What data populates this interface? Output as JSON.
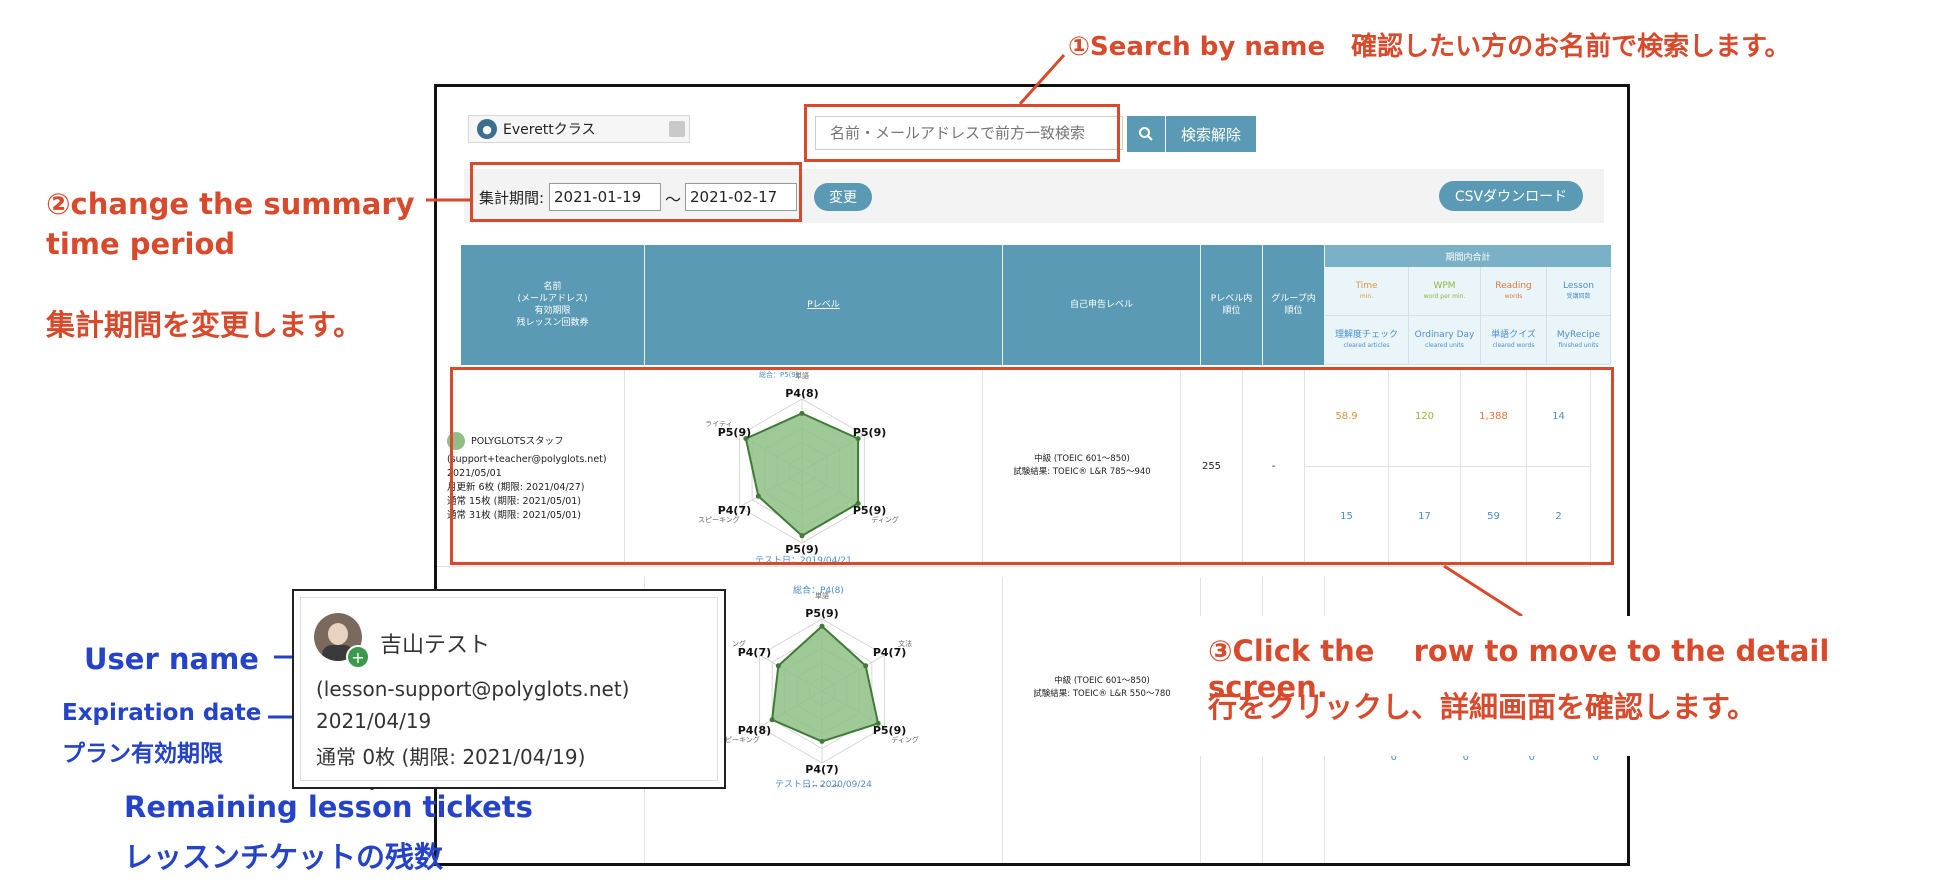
{
  "annotations": {
    "search": "①Search by name　確認したい方のお名前で検索します。",
    "period_en": "②change the summary\ntime period",
    "period_jp": "集計期間を変更します。",
    "click_en": "③Click the　 row to move to the detail screen.",
    "click_jp": "行をクリックし、詳細画面を確認します。",
    "user_name": "User name",
    "expiration_en": "Expiration date",
    "expiration_jp": "プラン有効期限",
    "tickets_en": "Remaining lesson tickets",
    "tickets_jp": "レッスンチケットの残数"
  },
  "toolbar": {
    "class_name": "Everettクラス",
    "search_placeholder": "名前・メールアドレスで前方一致検索",
    "clear_label": "検索解除",
    "period_label": "集計期間:",
    "date_from": "2021-01-19",
    "tilde": "〜",
    "date_to": "2021-02-17",
    "change_label": "変更",
    "csv_label": "CSVダウンロード"
  },
  "table": {
    "headers": {
      "name": "名前\n(メールアドレス)\n有効期限\n残レッスン回数券",
      "plevel": "Pレベル",
      "self": "自己申告レベル",
      "rank": "Pレベル内\n順位",
      "group_rank": "グループ内\n順位",
      "period_total": "期間内合計"
    },
    "subheaders": [
      {
        "top": "Time",
        "top_sub": "min.",
        "bottom": "理解度チェック",
        "bottom_sub": "cleared articles",
        "color": "#e0953b"
      },
      {
        "top": "WPM",
        "top_sub": "word per min.",
        "bottom": "Ordinary Day",
        "bottom_sub": "cleared units",
        "color": "#8bb93c"
      },
      {
        "top": "Reading",
        "top_sub": "words",
        "bottom": "単語クイズ",
        "bottom_sub": "cleared words",
        "color": "#e07a3b"
      },
      {
        "top": "Lesson",
        "top_sub": "受講回数",
        "bottom": "MyRecipe",
        "bottom_sub": "finished units",
        "color": "#4a8fd0"
      }
    ],
    "rows": [
      {
        "name": "POLYGLOTSスタッフ",
        "email": "(support+teacher@polyglots.net)",
        "expiry": "2021/05/01",
        "tickets": [
          "月更新 6枚 (期限: 2021/04/27)",
          "通常 15枚 (期限: 2021/05/01)",
          "通常 31枚 (期限: 2021/05/01)"
        ],
        "radar_labels": {
          "top": "P4(8)",
          "tr": "P5(9)",
          "br": "P5(9)",
          "bottom": "P5(9)",
          "bl": "P4(7)",
          "tl": "P5(9)"
        },
        "radar_axis": {
          "top": "単語",
          "tr": "",
          "br": "ディング",
          "bottom": "",
          "bl": "スピーキング",
          "tl": "ライティ"
        },
        "radar_values": [
          0.8,
          0.9,
          0.9,
          0.9,
          0.7,
          0.9
        ],
        "overall": "総合：P5(9)",
        "test_date": "テスト日：2019/04/21",
        "self_level": "中級 (TOEIC 601〜850)",
        "self_test": "試験結果: TOEIC® L&R 785〜940",
        "rank": "255",
        "group_rank": "-",
        "top_vals": [
          "58.9",
          "120",
          "1,388",
          "14"
        ],
        "bottom_vals": [
          "15",
          "17",
          "59",
          "2"
        ]
      },
      {
        "overall": "総合：P4(8)",
        "radar_labels": {
          "top": "P5(9)",
          "tr": "P4(7)",
          "br": "P5(9)",
          "bottom": "P4(7)",
          "bl": "P4(8)",
          "tl": "P4(7)"
        },
        "radar_axis": {
          "top": "単語",
          "tr": "文法",
          "br": "ディング",
          "bottom": "リスニング",
          "bl": "スピーキング",
          "tl": "ング"
        },
        "radar_values": [
          0.9,
          0.7,
          0.9,
          0.7,
          0.8,
          0.7
        ],
        "test_date": "テスト日：2020/09/24",
        "self_level": "中級 (TOEIC 601〜850)",
        "self_test": "試験結果: TOEIC® L&R 550〜780",
        "bottom_vals": [
          "0",
          "0",
          "0",
          "0"
        ]
      }
    ]
  },
  "zoom": {
    "name": "吉山テスト",
    "email": "(lesson-support@polyglots.net)",
    "expiry": "2021/04/19",
    "tickets": "通常 0枚 (期限: 2021/04/19)"
  },
  "colors": {
    "accent": "#5a9ab4",
    "annotation_red": "#d84a2b",
    "annotation_blue": "#2443c9",
    "radar_fill": "#8fbf86",
    "radar_stroke": "#3f7a36"
  }
}
